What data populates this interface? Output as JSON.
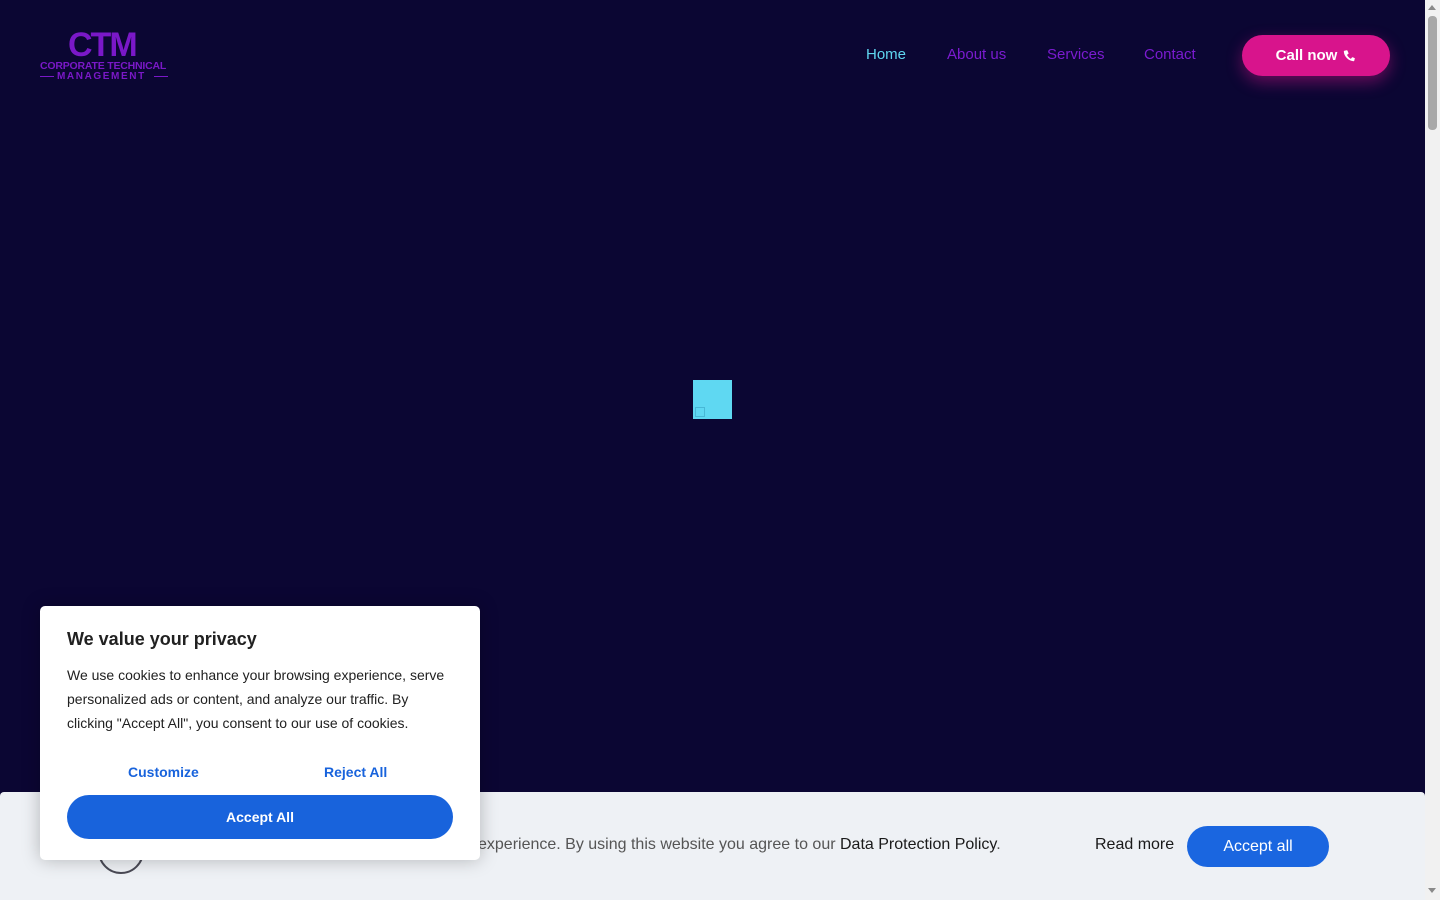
{
  "logo": {
    "mark": "CTM",
    "line1": "CORPORATE TECHNICAL",
    "line2": "MANAGEMENT"
  },
  "nav": {
    "items": [
      {
        "label": "Home",
        "active": true
      },
      {
        "label": "About us",
        "active": false
      },
      {
        "label": "Services",
        "active": false
      },
      {
        "label": "Contact",
        "active": false
      }
    ]
  },
  "header": {
    "call_label": "Call now",
    "call_icon": "phone-icon"
  },
  "colors": {
    "background": "#0b0633",
    "nav_link": "#7b1bd0",
    "nav_active": "#5fd6f0",
    "call_button": "#d8148c",
    "loader": "#5fd8f2",
    "consent_primary": "#1863dc"
  },
  "consent_bar": {
    "text_prefix": "experience. By using this website you agree to our ",
    "policy_link": "Data Protection Policy",
    "text_suffix": ".",
    "read_more": "Read more",
    "accept_label": "Accept all"
  },
  "privacy_modal": {
    "title": "We value your privacy",
    "body": "We use cookies to enhance your browsing experience, serve personalized ads or content, and analyze our traffic. By clicking \"Accept All\", you consent to our use of cookies.",
    "customize_label": "Customize",
    "reject_label": "Reject All",
    "accept_label": "Accept All"
  }
}
